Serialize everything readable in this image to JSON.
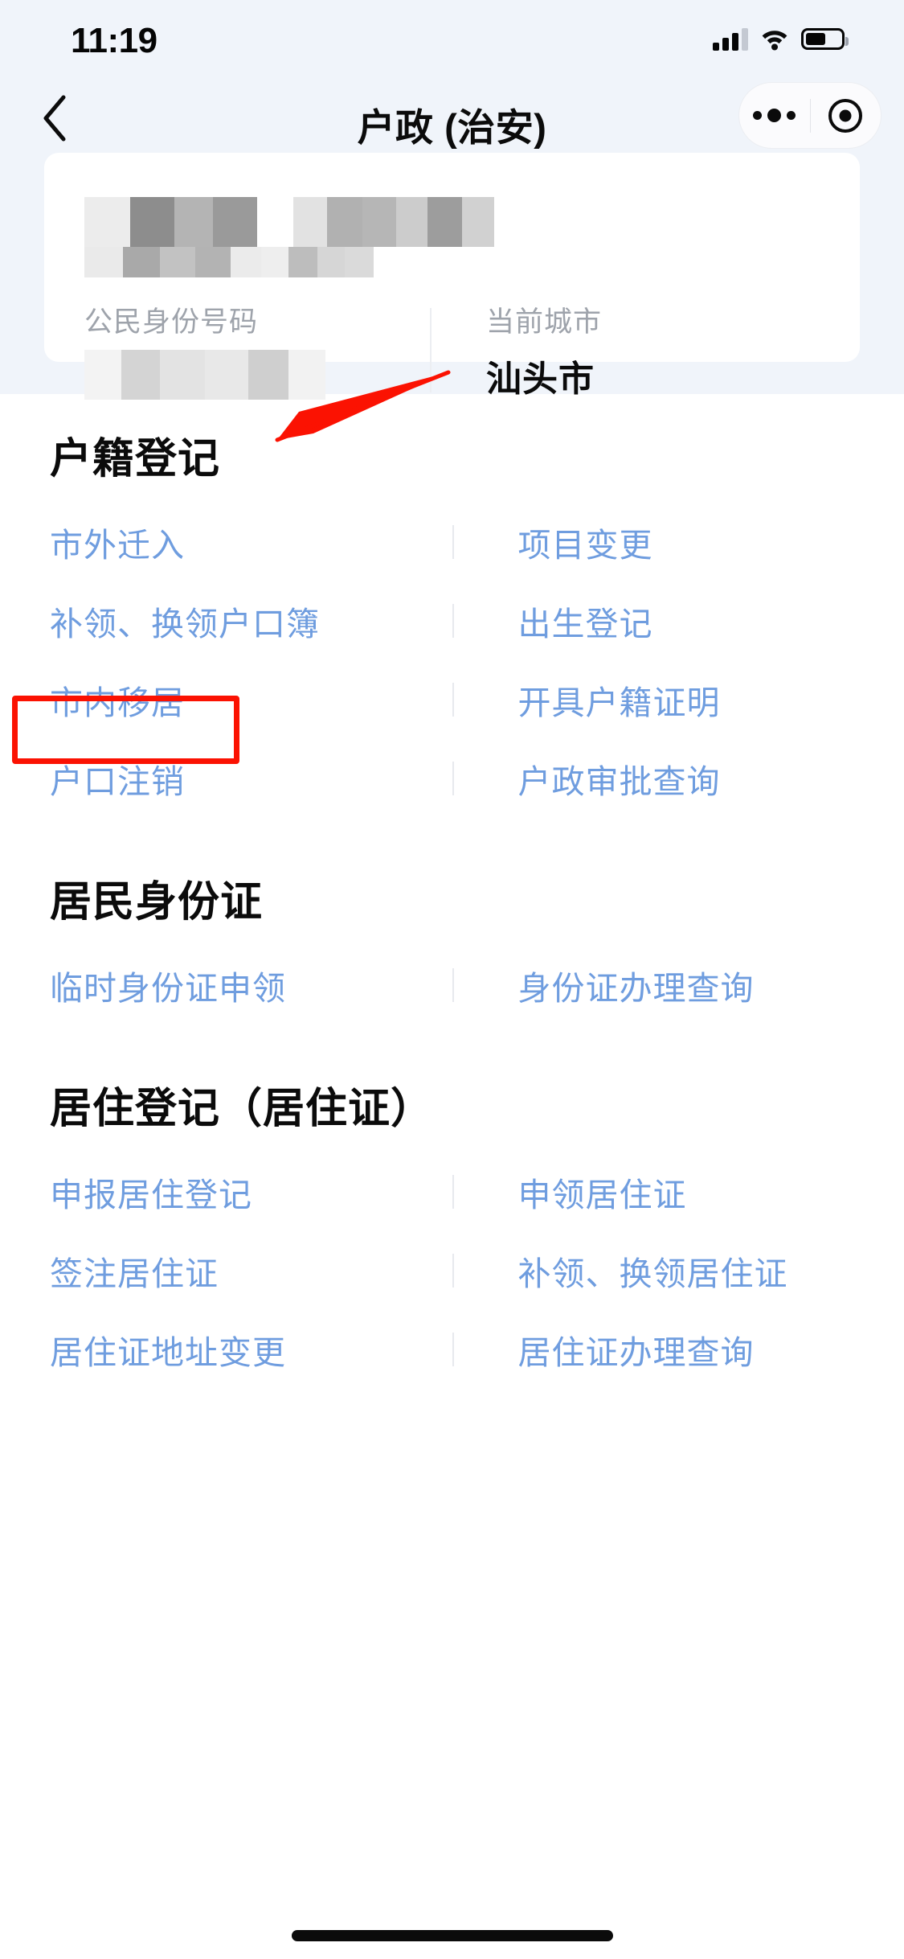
{
  "status_bar": {
    "time": "11:19",
    "signal_icon": "cellular-signal-icon",
    "wifi_icon": "wifi-icon",
    "battery_icon": "battery-icon"
  },
  "nav": {
    "back_icon": "back-chevron-icon",
    "title": "户政 (治安)",
    "capsule": {
      "more_icon": "more-dots-icon",
      "close_icon": "mini-program-close-icon"
    }
  },
  "info_card": {
    "name_redacted": true,
    "id_label": "公民身份号码",
    "id_value_redacted": true,
    "city_label": "当前城市",
    "city_value": "汕头市"
  },
  "sections": [
    {
      "title": "户籍登记",
      "items": [
        "市外迁入",
        "项目变更",
        "补领、换领户口簿",
        "出生登记",
        "市内移居",
        "开具户籍证明",
        "户口注销",
        "户政审批查询"
      ]
    },
    {
      "title": "居民身份证",
      "items": [
        "临时身份证申领",
        "身份证办理查询"
      ]
    },
    {
      "title": "居住登记（居住证）",
      "items": [
        "申报居住登记",
        "申领居住证",
        "签注居住证",
        "补领、换领居住证",
        "居住证地址变更",
        "居住证办理查询"
      ]
    }
  ],
  "annotations": {
    "highlight_color": "#fb1202",
    "highlighted_item": "市外迁入",
    "arrow_target": "市外迁入"
  },
  "colors": {
    "link_blue": "#6f9ddf",
    "page_bg": "#ffffff",
    "header_bg": "#f0f4fa",
    "label_gray": "#9ea3ab"
  }
}
